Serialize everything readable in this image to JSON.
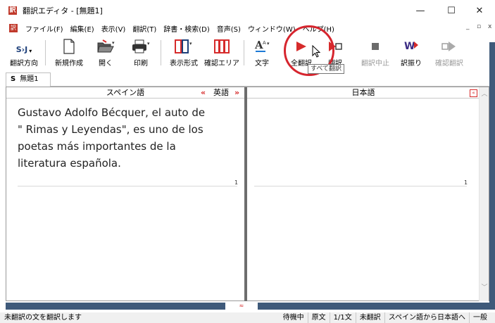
{
  "window": {
    "title": "翻訳エディタ - [無題1]",
    "app_icon_glyph": "訳",
    "minimize_glyph": "—",
    "maximize_glyph": "☐",
    "close_glyph": "✕"
  },
  "menu": {
    "items": [
      "ファイル(F)",
      "編集(E)",
      "表示(V)",
      "翻訳(T)",
      "辞書・検索(D)",
      "音声(S)",
      "ウィンドウ(W)",
      "ヘルプ(H)"
    ],
    "mdi_minimize": "_",
    "mdi_restore": "▫",
    "mdi_close": "x"
  },
  "toolbar": {
    "direction": "翻訳方向",
    "direction_icon": "S›J",
    "new": "新規作成",
    "open": "開く",
    "print": "印刷",
    "view_format": "表示形式",
    "confirm_area": "確認エリア",
    "font": "文字",
    "translate_all": "全翻訳",
    "translate": "翻訳",
    "stop": "翻訳中止",
    "assign": "訳振り",
    "confirm_translate": "確認翻訳"
  },
  "tooltip": "すべて翻訳",
  "tab": {
    "label": "無題1",
    "prefix": "S"
  },
  "editor": {
    "source_lang": "スペイン語",
    "swap_left": "«",
    "pivot_lang": "英語",
    "swap_right": "»",
    "target_lang": "日本語",
    "collapse_glyph": "«",
    "source_lines": [
      "Gustavo Adolfo Bécquer, el auto de",
      "\" Rimas y Leyendas\", es uno de los",
      "poetas más importantes de la",
      "literatura española."
    ],
    "source_num": "1",
    "target_num": "1"
  },
  "bottom_grip": "≈",
  "status": {
    "message": "未翻訳の文を翻訳します",
    "state": "待機中",
    "mode": "原文",
    "position": "1/1文",
    "translated": "未翻訳",
    "direction": "スペイン語から日本語へ",
    "field": "一般"
  },
  "colors": {
    "accent": "#d62b2b",
    "panel": "#3f5a7a"
  }
}
